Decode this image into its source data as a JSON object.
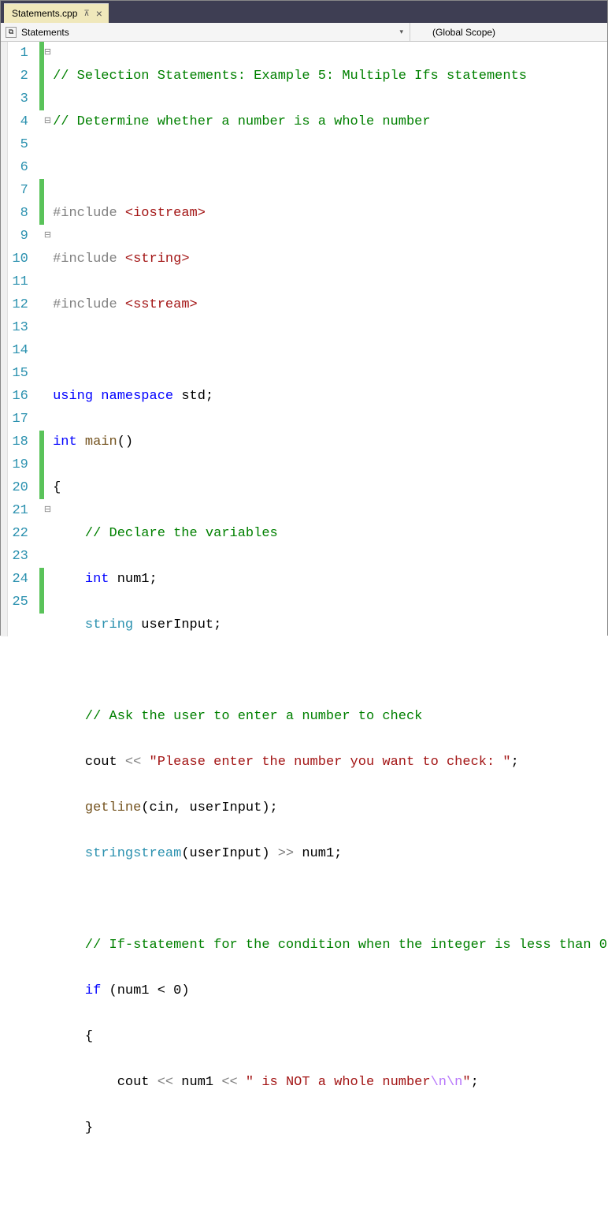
{
  "tab": {
    "filename": "Statements.cpp"
  },
  "nav": {
    "left": "Statements",
    "right": "(Global Scope)"
  },
  "lineNumbers": [
    "1",
    "2",
    "3",
    "4",
    "5",
    "6",
    "7",
    "8",
    "9",
    "10",
    "11",
    "12",
    "13",
    "14",
    "15",
    "16",
    "17",
    "18",
    "19",
    "20",
    "21",
    "22",
    "23",
    "24",
    "25"
  ],
  "changes": [
    true,
    true,
    true,
    false,
    false,
    false,
    true,
    true,
    false,
    false,
    false,
    false,
    false,
    false,
    false,
    false,
    false,
    true,
    true,
    true,
    false,
    false,
    false,
    true,
    true
  ],
  "folds": [
    "⊟",
    "",
    "",
    "⊟",
    "",
    "",
    "",
    "",
    "⊟",
    "",
    "",
    "",
    "",
    "",
    "",
    "",
    "",
    "",
    "",
    "",
    "⊟",
    "",
    "",
    "",
    ""
  ],
  "code": {
    "l1_comment": "// Selection Statements: Example 5: Multiple Ifs statements",
    "l2_comment": "// Determine whether a number is a whole number",
    "l4_include": "#include ",
    "l4_header": "<iostream>",
    "l5_include": "#include ",
    "l5_header": "<string>",
    "l6_include": "#include ",
    "l6_header": "<sstream>",
    "l8_using": "using",
    "l8_namespace": " namespace",
    "l8_std": " std;",
    "l9_int": "int",
    "l9_main": " main",
    "l9_paren": "()",
    "l10_brace": "{",
    "l11_comment": "    // Declare the variables",
    "l12_int": "    int",
    "l12_var": " num1;",
    "l13_string": "    string",
    "l13_var": " userInput;",
    "l15_comment": "    // Ask the user to enter a number to check",
    "l16_cout": "    cout ",
    "l16_op": "<<",
    "l16_str": " \"Please enter the number you want to check: \"",
    "l16_semi": ";",
    "l17_getline": "    getline",
    "l17_args": "(cin, userInput);",
    "l18_ss": "    stringstream",
    "l18_args": "(userInput) ",
    "l18_op": ">>",
    "l18_var": " num1;",
    "l20_comment": "    // If-statement for the condition when the integer is less than 0",
    "l21_if": "    if",
    "l21_cond": " (num1 < 0)",
    "l22_brace": "    {",
    "l23_cout": "        cout ",
    "l23_op1": "<<",
    "l23_var": " num1 ",
    "l23_op2": "<<",
    "l23_str1": " \" is NOT a whole number",
    "l23_esc": "\\n\\n",
    "l23_str2": "\"",
    "l23_semi": ";",
    "l24_brace": "    }"
  }
}
